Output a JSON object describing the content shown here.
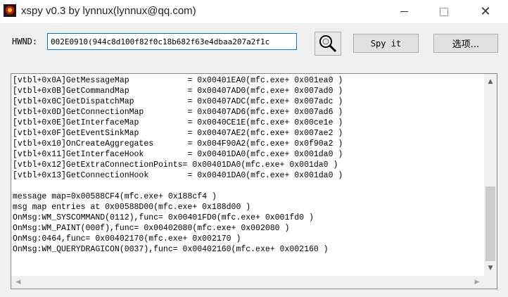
{
  "window": {
    "title": "xspy v0.3 by lynnux(lynnux@qq.com)",
    "controls": {
      "minimize_icon": "minimize-icon",
      "maximize_icon": "maximize-icon",
      "close_icon": "close-icon"
    }
  },
  "toolbar": {
    "hwnd_label": "HWND:",
    "hwnd_value": "002E0910(944c8d100f82f0c18b682f63e4dbaa207a2f1c",
    "finder_icon": "magnifier-icon",
    "spy_label": "Spy it",
    "options_label": "选项..."
  },
  "output": {
    "lines": [
      "[vtbl+0x0A]GetMessageMap            = 0x00401EA0(mfc.exe+ 0x001ea0 )",
      "[vtbl+0x0B]GetCommandMap            = 0x00407AD0(mfc.exe+ 0x007ad0 )",
      "[vtbl+0x0C]GetDispatchMap           = 0x00407ADC(mfc.exe+ 0x007adc )",
      "[vtbl+0x0D]GetConnectionMap         = 0x00407AD6(mfc.exe+ 0x007ad6 )",
      "[vtbl+0x0E]GetInterfaceMap          = 0x0040CE1E(mfc.exe+ 0x00ce1e )",
      "[vtbl+0x0F]GetEventSinkMap          = 0x00407AE2(mfc.exe+ 0x007ae2 )",
      "[vtbl+0x10]OnCreateAggregates       = 0x004F90A2(mfc.exe+ 0x0f90a2 )",
      "[vtbl+0x11]GetInterfaceHook         = 0x00401DA0(mfc.exe+ 0x001da0 )",
      "[vtbl+0x12]GetExtraConnectionPoints= 0x00401DA0(mfc.exe+ 0x001da0 )",
      "[vtbl+0x13]GetConnectionHook        = 0x00401DA0(mfc.exe+ 0x001da0 )",
      "",
      "message map=0x00588CF4(mfc.exe+ 0x188cf4 )",
      "msg map entries at 0x00588D00(mfc.exe+ 0x188d00 )",
      "OnMsg:WM_SYSCOMMAND(0112),func= 0x00401FD0(mfc.exe+ 0x001fd0 )",
      "OnMsg:WM_PAINT(000f),func= 0x00402080(mfc.exe+ 0x002080 )",
      "OnMsg:0464,func= 0x00402170(mfc.exe+ 0x002170 )",
      "OnMsg:WM_QUERYDRAGICON(0037),func= 0x00402160(mfc.exe+ 0x002160 )"
    ]
  },
  "scrollbars": {
    "up_icon": "scroll-up-icon",
    "down_icon": "scroll-down-icon",
    "left_icon": "scroll-left-icon",
    "right_icon": "scroll-right-icon"
  }
}
